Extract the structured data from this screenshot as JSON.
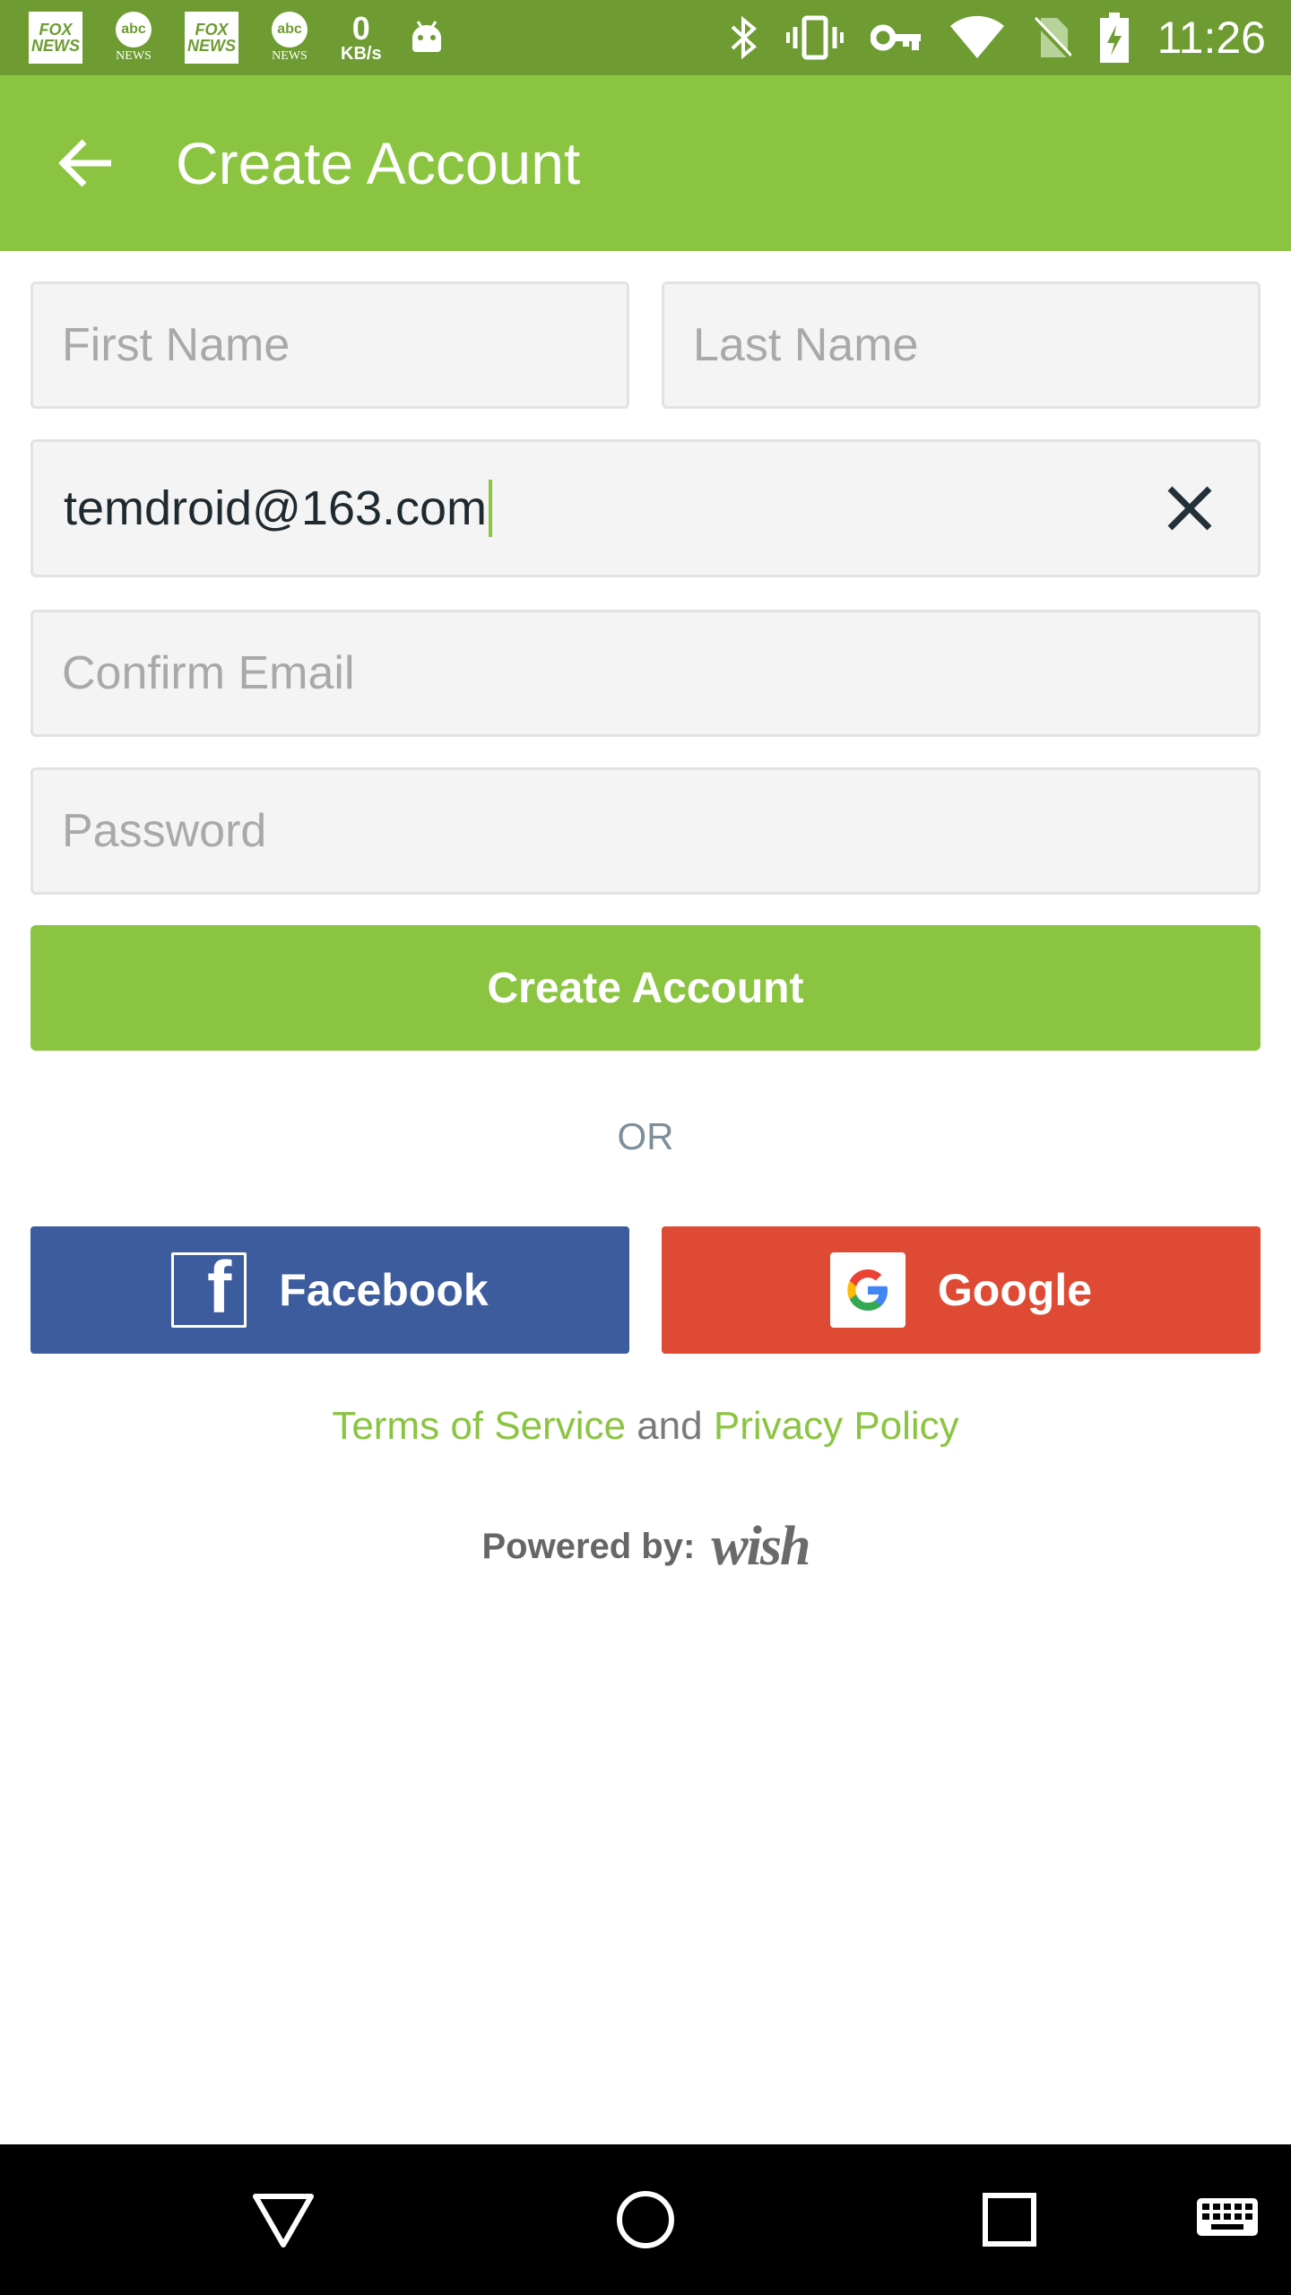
{
  "status_bar": {
    "notifications": [
      {
        "type": "fox",
        "line1": "FOX",
        "line2": "NEWS"
      },
      {
        "type": "abc",
        "logo": "abc",
        "label": "NEWS"
      },
      {
        "type": "fox",
        "line1": "FOX",
        "line2": "NEWS"
      },
      {
        "type": "abc",
        "logo": "abc",
        "label": "NEWS"
      }
    ],
    "data_speed_value": "0",
    "data_speed_unit": "KB/s",
    "time": "11:26",
    "icons": [
      "android-icon",
      "bluetooth-icon",
      "vibrate-icon",
      "vpn-key-icon",
      "wifi-icon",
      "no-sim-icon",
      "battery-charging-icon"
    ]
  },
  "app_bar": {
    "title": "Create Account",
    "back_icon": "arrow-back-icon"
  },
  "form": {
    "first_name": {
      "placeholder": "First Name",
      "value": ""
    },
    "last_name": {
      "placeholder": "Last Name",
      "value": ""
    },
    "email": {
      "value": "temdroid@163.com",
      "clear_icon": "close-icon"
    },
    "confirm_email": {
      "placeholder": "Confirm Email",
      "value": ""
    },
    "password": {
      "placeholder": "Password",
      "value": ""
    },
    "submit_label": "Create Account"
  },
  "divider_text": "OR",
  "social": {
    "facebook_label": "Facebook",
    "google_label": "Google"
  },
  "legal": {
    "terms_label": "Terms of Service",
    "and_text": "and",
    "privacy_label": "Privacy Policy"
  },
  "footer": {
    "powered_by_label": "Powered by:",
    "brand": "wish"
  },
  "colors": {
    "accent": "#8bc441",
    "status_bar": "#6e9c32",
    "facebook": "#3d5c9e",
    "google": "#de4a34"
  },
  "nav_bar": {
    "icons": [
      "back-triangle-icon",
      "home-circle-icon",
      "recents-square-icon",
      "keyboard-icon"
    ]
  }
}
